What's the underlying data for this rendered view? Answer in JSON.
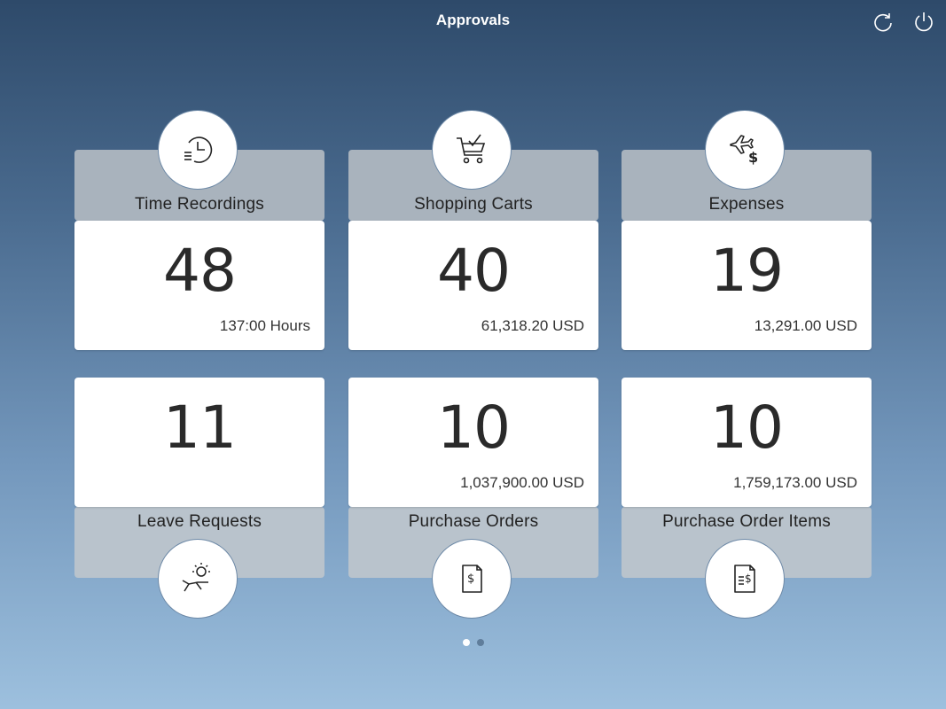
{
  "header": {
    "title": "Approvals"
  },
  "tiles": [
    {
      "label": "Time Recordings",
      "count": "48",
      "sub": "137:00 Hours",
      "icon": "time-entry-icon"
    },
    {
      "label": "Shopping Carts",
      "count": "40",
      "sub": "61,318.20 USD",
      "icon": "cart-approval-icon"
    },
    {
      "label": "Expenses",
      "count": "19",
      "sub": "13,291.00 USD",
      "icon": "travel-expense-icon"
    },
    {
      "label": "Leave Requests",
      "count": "11",
      "sub": "",
      "icon": "leave-request-icon"
    },
    {
      "label": "Purchase Orders",
      "count": "10",
      "sub": "1,037,900.00 USD",
      "icon": "purchase-order-icon"
    },
    {
      "label": "Purchase Order Items",
      "count": "10",
      "sub": "1,759,173.00 USD",
      "icon": "purchase-order-items-icon"
    }
  ],
  "pager": {
    "pages": 2,
    "active": 1
  }
}
